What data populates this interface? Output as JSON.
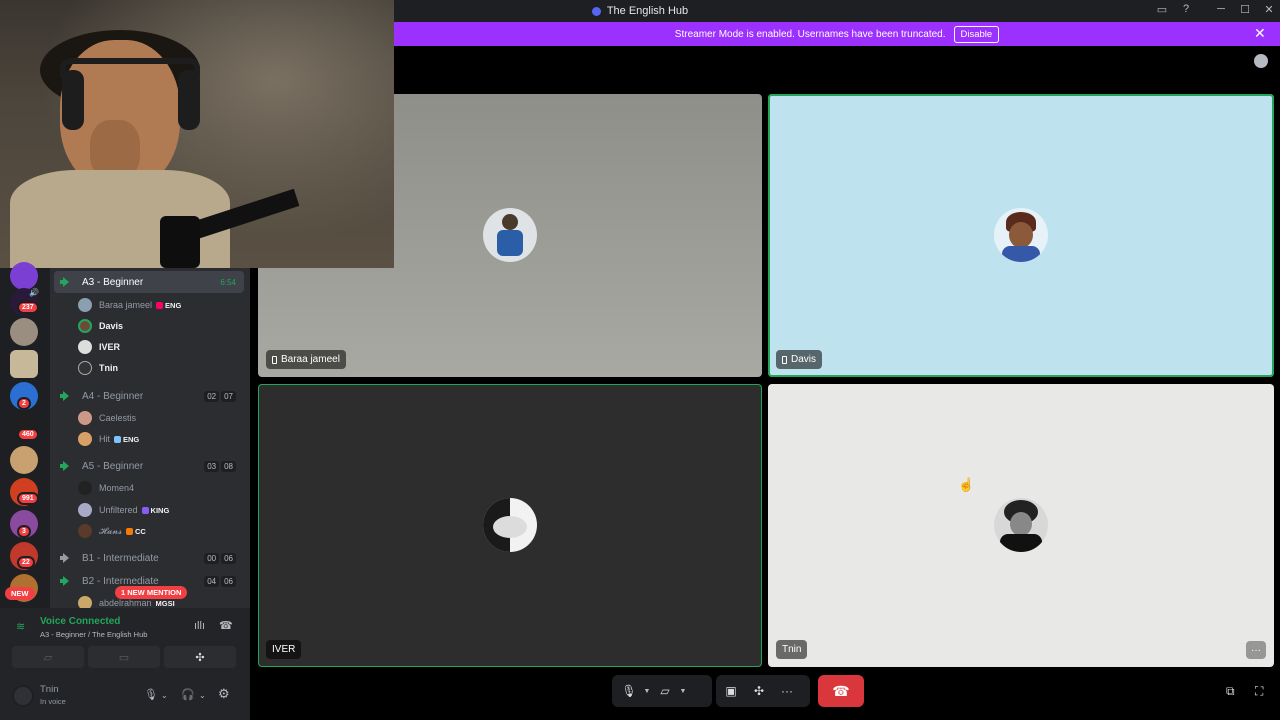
{
  "titlebar": {
    "title": "The English Hub"
  },
  "banner": {
    "message": "Streamer Mode is enabled. Usernames have been truncated.",
    "disable_label": "Disable"
  },
  "servers": {
    "badges": [
      "237",
      "2",
      "460",
      "991",
      "3",
      "22"
    ],
    "new_label": "NEW"
  },
  "channels": [
    {
      "name": "A3 - Beginner",
      "meta": "6:54",
      "active": true,
      "users": [
        {
          "name": "Baraa jameel",
          "tag": "ENG",
          "bold": false
        },
        {
          "name": "Davis",
          "tag": "",
          "bold": true
        },
        {
          "name": "IVER",
          "tag": "",
          "bold": true
        },
        {
          "name": "Tnin",
          "tag": "",
          "bold": true
        }
      ]
    },
    {
      "name": "A4 - Beginner",
      "meta_a": "02",
      "meta_b": "07",
      "users": [
        {
          "name": "Caelestis",
          "tag": ""
        },
        {
          "name": "Hit",
          "tag": "ENG"
        }
      ]
    },
    {
      "name": "A5 - Beginner",
      "meta_a": "03",
      "meta_b": "08",
      "users": [
        {
          "name": "Momen4",
          "tag": ""
        },
        {
          "name": "Unfiltered",
          "tag": "KING"
        },
        {
          "name": "𝓗𝓪𝓷𝓼",
          "tag": "CC"
        }
      ]
    },
    {
      "name": "B1 - Intermediate",
      "meta_a": "00",
      "meta_b": "06"
    },
    {
      "name": "B2 - Intermediate",
      "meta_a": "04",
      "meta_b": "06",
      "users": [
        {
          "name": "abdelrahman",
          "tag": "MGSI"
        }
      ]
    }
  ],
  "mention_pill": "1 NEW MENTION",
  "voice": {
    "status": "Voice Connected",
    "channel": "A3 - Beginner / The English Hub"
  },
  "self": {
    "name": "Tnin",
    "status": "In voice"
  },
  "tiles": [
    {
      "name": "Baraa jameel",
      "mobile": true,
      "bg": "#9a9a94"
    },
    {
      "name": "Davis",
      "mobile": true,
      "bg": "#bfe3ee"
    },
    {
      "name": "IVER",
      "mobile": false,
      "bg": "#2d2d2d"
    },
    {
      "name": "Tnin",
      "mobile": false,
      "bg": "#e8e8e6"
    }
  ],
  "colors": {
    "streamer_banner": "#9b30ff",
    "speaking_outline": "#23a55a",
    "hangup": "#da373c",
    "voice_connected": "#23a55a"
  },
  "controls": {
    "more_glyph": "···"
  }
}
